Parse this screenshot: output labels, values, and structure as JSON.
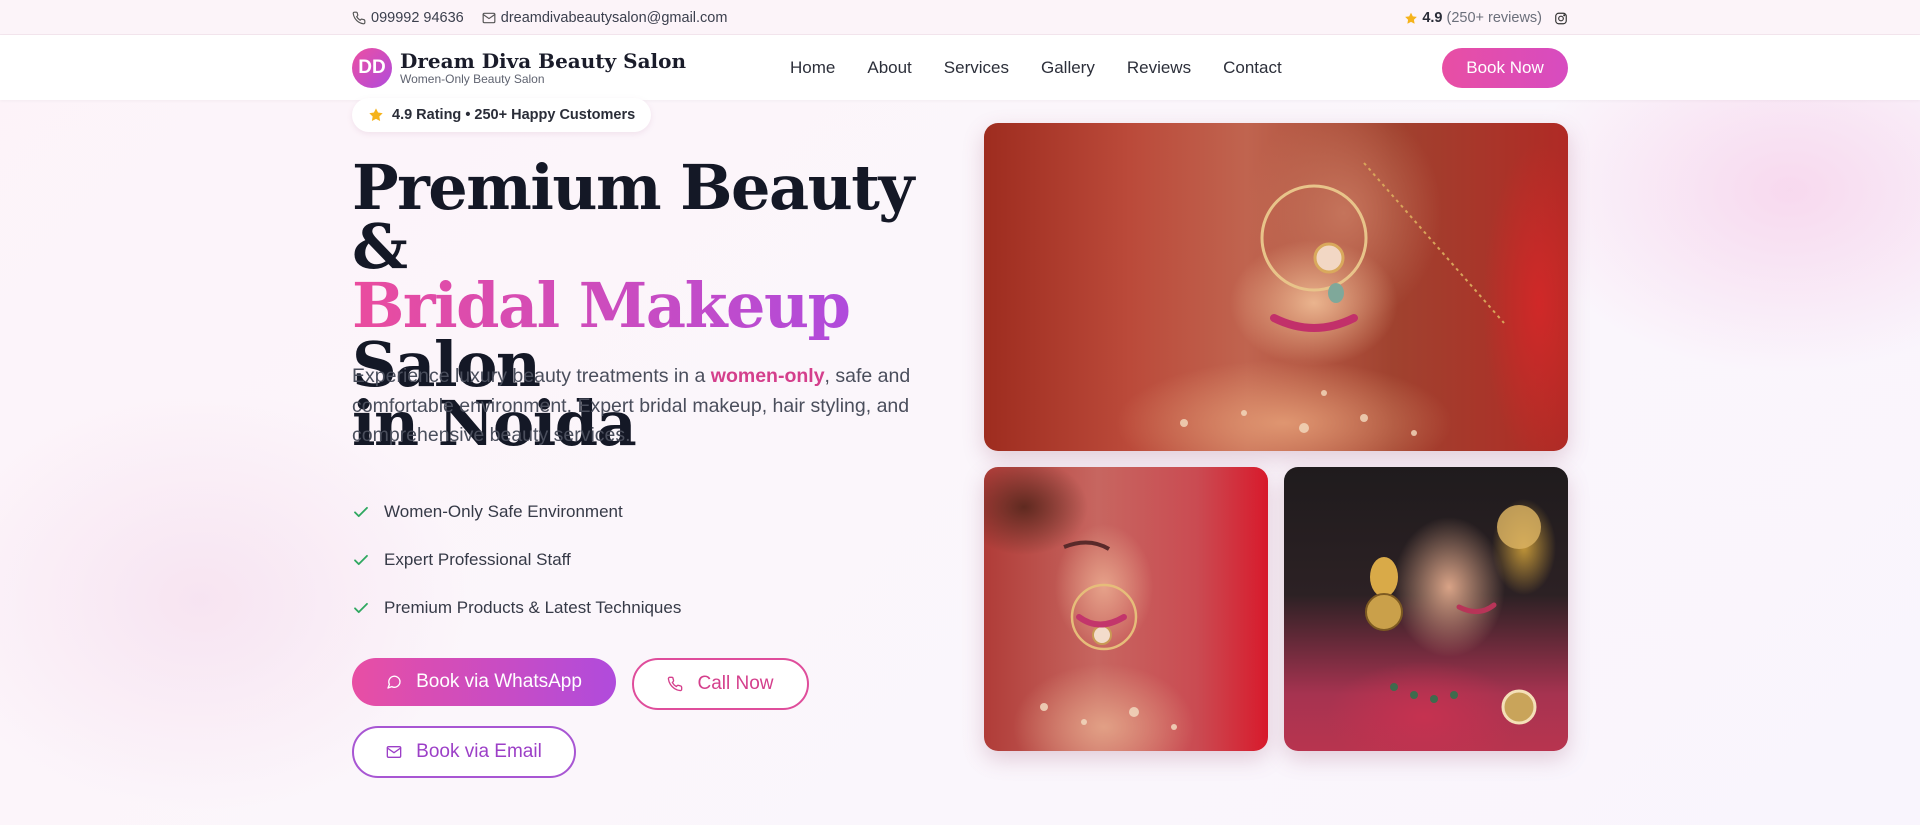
{
  "topbar": {
    "phone": "099992 94636",
    "email": "dreamdivabeautysalon@gmail.com",
    "rating_value": "4.9",
    "rating_reviews": "(250+ reviews)"
  },
  "header": {
    "logo_initials": "DD",
    "brand_name": "Dream Diva Beauty Salon",
    "brand_tagline": "Women-Only Beauty Salon",
    "nav": [
      "Home",
      "About",
      "Services",
      "Gallery",
      "Reviews",
      "Contact"
    ],
    "cta_label": "Book Now"
  },
  "hero": {
    "rating_pill": "4.9 Rating • 250+ Happy Customers",
    "title_line1": "Premium Beauty &",
    "title_highlight": "Bridal Makeup",
    "title_line2_rest": " Salon",
    "title_line3": "in Noida",
    "desc_before": "Experience luxury beauty treatments in a ",
    "desc_highlight": "women-only",
    "desc_after": ", safe and comfortable environment. Expert bridal makeup, hair styling, and comprehensive beauty services.",
    "features": [
      "Women-Only Safe Environment",
      "Expert Professional Staff",
      "Premium Products & Latest Techniques"
    ],
    "buttons": {
      "whatsapp": "Book via WhatsApp",
      "call": "Call Now",
      "email": "Book via Email"
    }
  },
  "colors": {
    "brand_pink": "#e84ea4",
    "brand_purple": "#b04bdc",
    "star": "#f5b31b",
    "check": "#2fa860"
  },
  "icons": {
    "phone": "phone-icon",
    "email": "mail-icon",
    "star": "star-icon",
    "instagram": "instagram-icon",
    "whatsapp": "chat-bubble-icon",
    "check": "check-icon"
  }
}
